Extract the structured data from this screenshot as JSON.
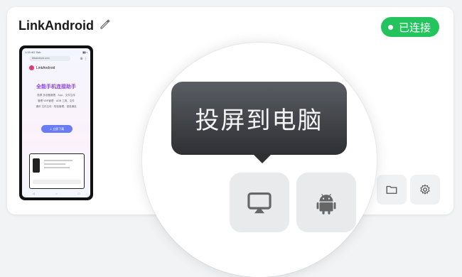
{
  "device": {
    "name": "LinkAndroid",
    "status": "已连接"
  },
  "phone_screen": {
    "status_time": "1:15 4G Sub",
    "url": "linkandroid.com",
    "brand": "LinkAndroid",
    "headline": "全能手机连接助手",
    "lines": [
      "投屏 多设备管理、App、文件互传",
      "管理 WiFi管理 · ADB 工具、文件",
      "通讯 文件互传 · 短信管理、语音通话"
    ],
    "download_button": "↓ 立即下载"
  },
  "tooltip": {
    "text": "投屏到电脑"
  },
  "icons": {
    "edit": "pencil-icon",
    "cast": "cast-to-screen-icon",
    "android": "android-icon",
    "folder": "folder-icon",
    "settings": "gear-icon"
  },
  "colors": {
    "status_green": "#23c45e",
    "tooltip_bg": "#3a3c40"
  }
}
